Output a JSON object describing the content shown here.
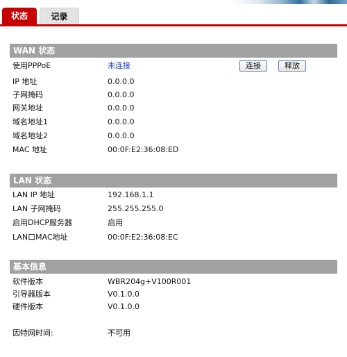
{
  "tabs": {
    "status": "状态",
    "log": "记录"
  },
  "wan": {
    "title": "WAN 状态",
    "rows": [
      {
        "label": "使用PPPoE",
        "value": "未连接"
      },
      {
        "label": "IP 地址",
        "value": "0.0.0.0"
      },
      {
        "label": "子网掩码",
        "value": "0.0.0.0"
      },
      {
        "label": "网关地址",
        "value": "0.0.0.0"
      },
      {
        "label": "域名地址1",
        "value": "0.0.0.0"
      },
      {
        "label": "域名地址2",
        "value": "0.0.0.0"
      },
      {
        "label": "MAC 地址",
        "value": "00:0F:E2:36:08:ED"
      }
    ],
    "connect_label": "连接",
    "release_label": "释放"
  },
  "lan": {
    "title": "LAN 状态",
    "rows": [
      {
        "label": "LAN IP 地址",
        "value": "192.168.1.1"
      },
      {
        "label": "LAN 子网掩码",
        "value": "255.255.255.0"
      },
      {
        "label": "启用DHCP服务器",
        "value": "启用"
      },
      {
        "label": "LAN口MAC地址",
        "value": "00:0F:E2:36:08:EC"
      }
    ]
  },
  "basic": {
    "title": "基本信息",
    "rows": [
      {
        "label": "软件版本",
        "value": "WBR204g+V100R001"
      },
      {
        "label": "引导器版本",
        "value": "V0.1.0.0"
      },
      {
        "label": "硬件版本",
        "value": "V0.1.0.0"
      }
    ],
    "uptime_label": "因特网时间:",
    "uptime_value": "不可用"
  },
  "colors": {
    "accent": "#c80000",
    "header_bg": "#a1a1a1",
    "link": "#1a3ec6"
  }
}
